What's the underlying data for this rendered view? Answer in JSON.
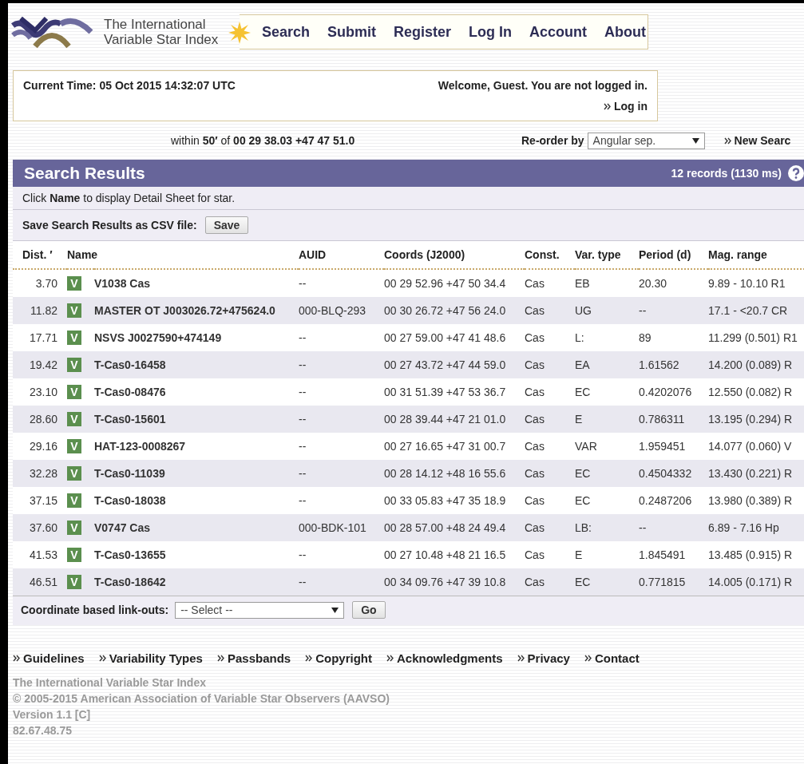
{
  "header": {
    "logo_text": [
      "The International",
      "Variable Star Index"
    ],
    "nav": [
      "Search",
      "Submit",
      "Register",
      "Log In",
      "Account",
      "About"
    ]
  },
  "status": {
    "current_time": "Current Time: 05 Oct 2015 14:32:07 UTC",
    "welcome": "Welcome, Guest. You are not logged in.",
    "login_link": "Log in"
  },
  "search_bar": {
    "query": "within **50′** of **00 29 38.03 +47 47 51.0**",
    "reorder_label": "Re-order by",
    "reorder_value": "Angular sep.",
    "new_search": "New Searc"
  },
  "results": {
    "title": "Search Results",
    "count": "12 records (1130 ms)",
    "hint": "Click **Name** to display Detail Sheet for star.",
    "save_label": "Save Search Results as CSV file:",
    "save_button": "Save",
    "columns": [
      "Dist. ′",
      "Name",
      "AUID",
      "Coords (J2000)",
      "Const.",
      "Var. type",
      "Period (d)",
      "Mag. range"
    ],
    "rows": [
      {
        "dist": "3.70",
        "badge": "V",
        "name": "V1038 Cas",
        "auid": "--",
        "coords": "00 29 52.96 +47 50 34.4",
        "const": "Cas",
        "var_type": "EB",
        "period": "20.30",
        "mag_range": "9.89 - 10.10 R1"
      },
      {
        "dist": "11.82",
        "badge": "V",
        "name": "MASTER OT J003026.72+475624.0",
        "auid": "000-BLQ-293",
        "coords": "00 30 26.72 +47 56 24.0",
        "const": "Cas",
        "var_type": "UG",
        "period": "--",
        "mag_range": "17.1 - <20.7 CR"
      },
      {
        "dist": "17.71",
        "badge": "V",
        "name": "NSVS J0027590+474149",
        "auid": "--",
        "coords": "00 27 59.00 +47 41 48.6",
        "const": "Cas",
        "var_type": "L:",
        "period": "89",
        "mag_range": "11.299 (0.501) R1"
      },
      {
        "dist": "19.42",
        "badge": "V",
        "name": "T-Cas0-16458",
        "auid": "--",
        "coords": "00 27 43.72 +47 44 59.0",
        "const": "Cas",
        "var_type": "EA",
        "period": "1.61562",
        "mag_range": "14.200 (0.089) R"
      },
      {
        "dist": "23.10",
        "badge": "V",
        "name": "T-Cas0-08476",
        "auid": "--",
        "coords": "00 31 51.39 +47 53 36.7",
        "const": "Cas",
        "var_type": "EC",
        "period": "0.4202076",
        "mag_range": "12.550 (0.082) R"
      },
      {
        "dist": "28.60",
        "badge": "V",
        "name": "T-Cas0-15601",
        "auid": "--",
        "coords": "00 28 39.44 +47 21 01.0",
        "const": "Cas",
        "var_type": "E",
        "period": "0.786311",
        "mag_range": "13.195 (0.294) R"
      },
      {
        "dist": "29.16",
        "badge": "V",
        "name": "HAT-123-0008267",
        "auid": "--",
        "coords": "00 27 16.65 +47 31 00.7",
        "const": "Cas",
        "var_type": "VAR",
        "period": "1.959451",
        "mag_range": "14.077 (0.060) V"
      },
      {
        "dist": "32.28",
        "badge": "V",
        "name": "T-Cas0-11039",
        "auid": "--",
        "coords": "00 28 14.12 +48 16 55.6",
        "const": "Cas",
        "var_type": "EC",
        "period": "0.4504332",
        "mag_range": "13.430 (0.221) R"
      },
      {
        "dist": "37.15",
        "badge": "V",
        "name": "T-Cas0-18038",
        "auid": "--",
        "coords": "00 33 05.83 +47 35 18.9",
        "const": "Cas",
        "var_type": "EC",
        "period": "0.2487206",
        "mag_range": "13.980 (0.389) R"
      },
      {
        "dist": "37.60",
        "badge": "V",
        "name": "V0747 Cas",
        "auid": "000-BDK-101",
        "coords": "00 28 57.00 +48 24 49.4",
        "const": "Cas",
        "var_type": "LB:",
        "period": "--",
        "mag_range": "6.89 - 7.16 Hp"
      },
      {
        "dist": "41.53",
        "badge": "V",
        "name": "T-Cas0-13655",
        "auid": "--",
        "coords": "00 27 10.48 +48 21 16.5",
        "const": "Cas",
        "var_type": "E",
        "period": "1.845491",
        "mag_range": "13.485 (0.915) R"
      },
      {
        "dist": "46.51",
        "badge": "V",
        "name": "T-Cas0-18642",
        "auid": "--",
        "coords": "00 34 09.76 +47 39 10.8",
        "const": "Cas",
        "var_type": "EC",
        "period": "0.771815",
        "mag_range": "14.005 (0.171) R"
      }
    ],
    "linkouts_label": "Coordinate based link-outs:",
    "linkouts_value": "-- Select --",
    "go_button": "Go"
  },
  "footer": {
    "links": [
      "Guidelines",
      "Variability Types",
      "Passbands",
      "Copyright",
      "Acknowledgments",
      "Privacy",
      "Contact"
    ],
    "legal": [
      "The International Variable Star Index",
      "© 2005-2015 American Association of Variable Star Observers (AAVSO)",
      "Version 1.1 [C]",
      "82.67.48.75"
    ]
  }
}
